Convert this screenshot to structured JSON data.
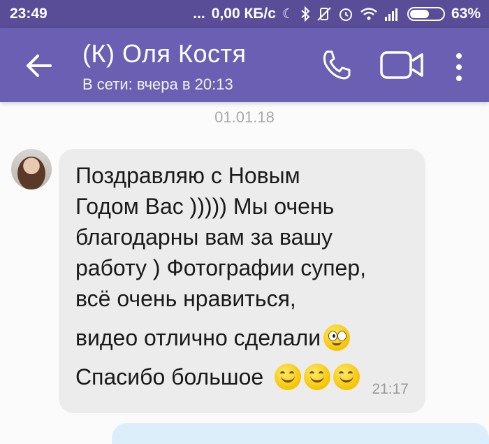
{
  "statusbar": {
    "time": "23:49",
    "dots": "...",
    "network_speed": "0,00 КБ/с",
    "battery": "63%",
    "battery_level": 0.63
  },
  "header": {
    "contact_name": "(К) Оля Костя",
    "status": "В сети: вчера в 20:13"
  },
  "chat": {
    "date_separator": "01.01.18",
    "message": {
      "lines": [
        "Поздравляю  с Новым",
        "Годом Вас )))))  Мы очень",
        "благодарны  вам за вашу",
        "работу ) Фотографии супер,",
        "всё очень нравиться,",
        "видео отлично сделали",
        "Спасибо большое"
      ],
      "time": "21:17"
    }
  },
  "colors": {
    "statusbar": "#5a4d98",
    "appbar": "#6b5fb3",
    "incoming_bubble": "#ececec",
    "outgoing_bubble": "#ddeefb"
  }
}
